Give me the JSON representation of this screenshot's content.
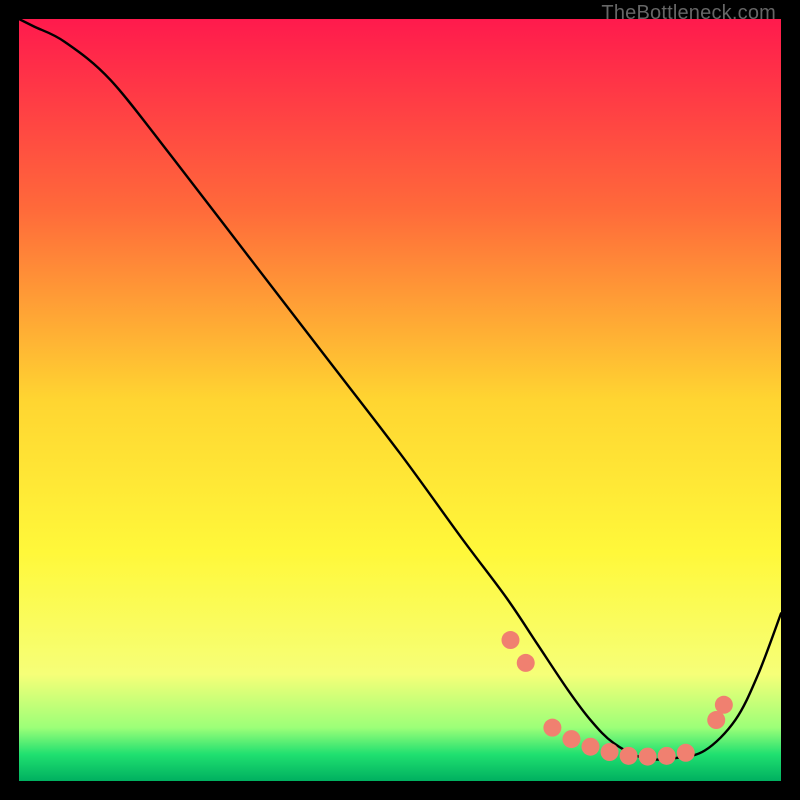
{
  "watermark": "TheBottleneck.com",
  "chart_data": {
    "type": "line",
    "title": "",
    "xlabel": "",
    "ylabel": "",
    "xlim": [
      0,
      100
    ],
    "ylim": [
      0,
      100
    ],
    "background_gradient": {
      "stops": [
        {
          "pos": 0.0,
          "color": "#ff1a4d"
        },
        {
          "pos": 0.25,
          "color": "#ff6a3a"
        },
        {
          "pos": 0.5,
          "color": "#ffd531"
        },
        {
          "pos": 0.7,
          "color": "#fff83a"
        },
        {
          "pos": 0.86,
          "color": "#f6ff78"
        },
        {
          "pos": 0.93,
          "color": "#9cff78"
        },
        {
          "pos": 0.965,
          "color": "#20e070"
        },
        {
          "pos": 1.0,
          "color": "#00b060"
        }
      ]
    },
    "curve": {
      "x": [
        0,
        2,
        6,
        12,
        20,
        30,
        40,
        50,
        58,
        64,
        68,
        72,
        75,
        78,
        82,
        86,
        90,
        94,
        97,
        100
      ],
      "y": [
        100,
        99,
        97,
        92,
        82,
        69,
        56,
        43,
        32,
        24,
        18,
        12,
        8,
        5,
        3,
        3,
        4,
        8,
        14,
        22
      ]
    },
    "markers": {
      "color": "#f08070",
      "radius": 9,
      "points": [
        {
          "x": 64.5,
          "y": 18.5
        },
        {
          "x": 66.5,
          "y": 15.5
        },
        {
          "x": 70.0,
          "y": 7.0
        },
        {
          "x": 72.5,
          "y": 5.5
        },
        {
          "x": 75.0,
          "y": 4.5
        },
        {
          "x": 77.5,
          "y": 3.8
        },
        {
          "x": 80.0,
          "y": 3.3
        },
        {
          "x": 82.5,
          "y": 3.2
        },
        {
          "x": 85.0,
          "y": 3.3
        },
        {
          "x": 87.5,
          "y": 3.7
        },
        {
          "x": 91.5,
          "y": 8.0
        },
        {
          "x": 92.5,
          "y": 10.0
        }
      ]
    }
  }
}
